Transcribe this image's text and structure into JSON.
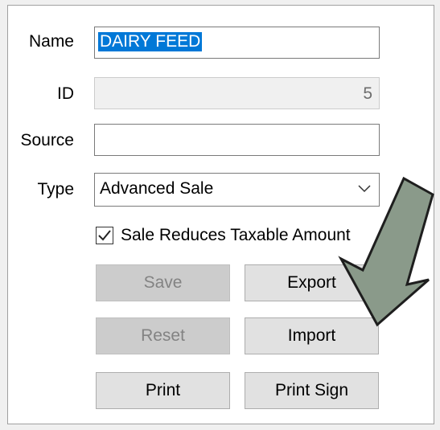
{
  "form": {
    "name_label": "Name",
    "name_value": "DAIRY FEED",
    "id_label": "ID",
    "id_value": "5",
    "source_label": "Source",
    "source_value": "",
    "type_label": "Type",
    "type_value": "Advanced Sale",
    "checkbox_label": "Sale Reduces Taxable Amount",
    "checkbox_checked": true
  },
  "buttons": {
    "save": "Save",
    "export": "Export",
    "reset": "Reset",
    "import": "Import",
    "print": "Print",
    "print_sign": "Print Sign"
  },
  "annotation": {
    "arrow_color": "#8a9a8a",
    "arrow_outline": "#1e1e1e",
    "arrow_points_to": "import-button"
  },
  "colors": {
    "selection": "#0078d7",
    "disabled_button": "#cccccc",
    "button": "#e1e1e1"
  }
}
